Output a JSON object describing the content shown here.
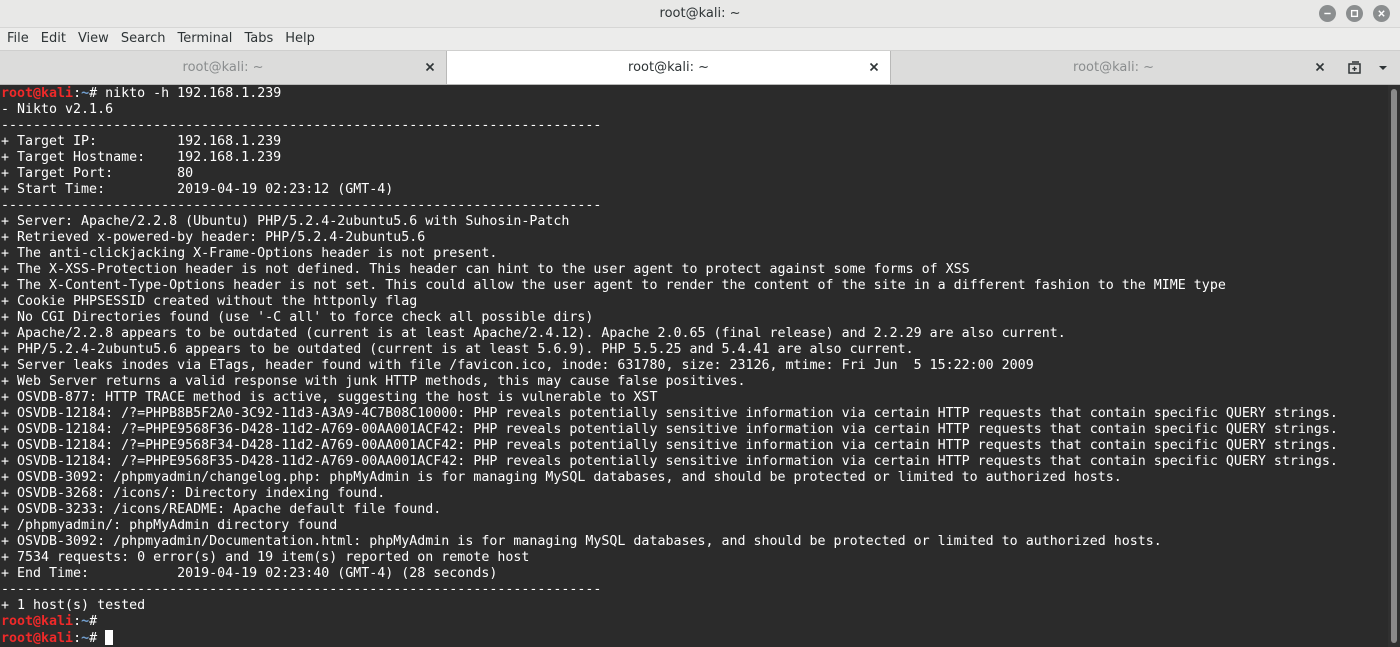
{
  "window": {
    "title": "root@kali: ~"
  },
  "menu": [
    "File",
    "Edit",
    "View",
    "Search",
    "Terminal",
    "Tabs",
    "Help"
  ],
  "tabs": [
    {
      "label": "root@kali: ~",
      "active": false
    },
    {
      "label": "root@kali: ~",
      "active": true
    },
    {
      "label": "root@kali: ~",
      "active": false
    }
  ],
  "colors": {
    "prompt_user": "#ef2929",
    "terminal_bg": "#2b2b2b",
    "terminal_fg": "#ffffff"
  },
  "terminal": {
    "prompt_user": "root@kali",
    "prompt_sep": ":",
    "prompt_path": "~",
    "prompt_symbol": "# ",
    "command": "nikto -h 192.168.1.239",
    "output": [
      "- Nikto v2.1.6",
      "---------------------------------------------------------------------------",
      "+ Target IP:          192.168.1.239",
      "+ Target Hostname:    192.168.1.239",
      "+ Target Port:        80",
      "+ Start Time:         2019-04-19 02:23:12 (GMT-4)",
      "---------------------------------------------------------------------------",
      "+ Server: Apache/2.2.8 (Ubuntu) PHP/5.2.4-2ubuntu5.6 with Suhosin-Patch",
      "+ Retrieved x-powered-by header: PHP/5.2.4-2ubuntu5.6",
      "+ The anti-clickjacking X-Frame-Options header is not present.",
      "+ The X-XSS-Protection header is not defined. This header can hint to the user agent to protect against some forms of XSS",
      "+ The X-Content-Type-Options header is not set. This could allow the user agent to render the content of the site in a different fashion to the MIME type",
      "+ Cookie PHPSESSID created without the httponly flag",
      "+ No CGI Directories found (use '-C all' to force check all possible dirs)",
      "+ Apache/2.2.8 appears to be outdated (current is at least Apache/2.4.12). Apache 2.0.65 (final release) and 2.2.29 are also current.",
      "+ PHP/5.2.4-2ubuntu5.6 appears to be outdated (current is at least 5.6.9). PHP 5.5.25 and 5.4.41 are also current.",
      "+ Server leaks inodes via ETags, header found with file /favicon.ico, inode: 631780, size: 23126, mtime: Fri Jun  5 15:22:00 2009",
      "+ Web Server returns a valid response with junk HTTP methods, this may cause false positives.",
      "+ OSVDB-877: HTTP TRACE method is active, suggesting the host is vulnerable to XST",
      "+ OSVDB-12184: /?=PHPB8B5F2A0-3C92-11d3-A3A9-4C7B08C10000: PHP reveals potentially sensitive information via certain HTTP requests that contain specific QUERY strings.",
      "+ OSVDB-12184: /?=PHPE9568F36-D428-11d2-A769-00AA001ACF42: PHP reveals potentially sensitive information via certain HTTP requests that contain specific QUERY strings.",
      "+ OSVDB-12184: /?=PHPE9568F34-D428-11d2-A769-00AA001ACF42: PHP reveals potentially sensitive information via certain HTTP requests that contain specific QUERY strings.",
      "+ OSVDB-12184: /?=PHPE9568F35-D428-11d2-A769-00AA001ACF42: PHP reveals potentially sensitive information via certain HTTP requests that contain specific QUERY strings.",
      "+ OSVDB-3092: /phpmyadmin/changelog.php: phpMyAdmin is for managing MySQL databases, and should be protected or limited to authorized hosts.",
      "+ OSVDB-3268: /icons/: Directory indexing found.",
      "+ OSVDB-3233: /icons/README: Apache default file found.",
      "+ /phpmyadmin/: phpMyAdmin directory found",
      "+ OSVDB-3092: /phpmyadmin/Documentation.html: phpMyAdmin is for managing MySQL databases, and should be protected or limited to authorized hosts.",
      "+ 7534 requests: 0 error(s) and 19 item(s) reported on remote host",
      "+ End Time:           2019-04-19 02:23:40 (GMT-4) (28 seconds)",
      "---------------------------------------------------------------------------",
      "+ 1 host(s) tested"
    ]
  }
}
